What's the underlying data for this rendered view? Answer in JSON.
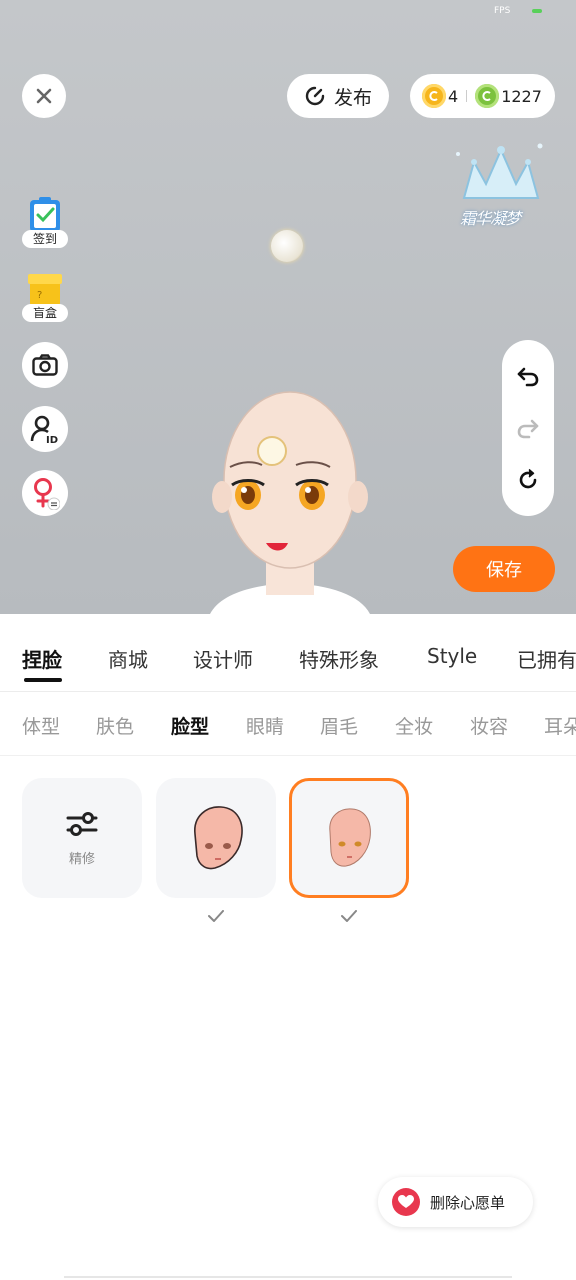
{
  "status": {
    "fps_label": "FPS"
  },
  "top_bar": {
    "publish_label": "发布",
    "gold_coins": "4",
    "green_coins": "1227",
    "logo_text": "霜华凝梦"
  },
  "side_menu": {
    "checkin_label": "签到",
    "blindbox_label": "盲盒"
  },
  "save_label": "保存",
  "main_tabs": [
    {
      "label": "捏脸",
      "active": true
    },
    {
      "label": "商城",
      "active": false
    },
    {
      "label": "设计师",
      "active": false
    },
    {
      "label": "特殊形象",
      "active": false
    },
    {
      "label": "Style",
      "active": false
    },
    {
      "label": "已拥有",
      "active": false
    }
  ],
  "sub_tabs": [
    {
      "label": "体型",
      "active": false
    },
    {
      "label": "肤色",
      "active": false
    },
    {
      "label": "脸型",
      "active": true
    },
    {
      "label": "眼睛",
      "active": false
    },
    {
      "label": "眉毛",
      "active": false
    },
    {
      "label": "全妆",
      "active": false
    },
    {
      "label": "妆容",
      "active": false
    },
    {
      "label": "耳朵",
      "active": false
    }
  ],
  "cards": {
    "refine_label": "精修"
  },
  "wishlist_label": "删除心愿单",
  "colors": {
    "accent": "#ff7314",
    "selected_border": "#ff7e21",
    "wish_red": "#e8374e"
  }
}
